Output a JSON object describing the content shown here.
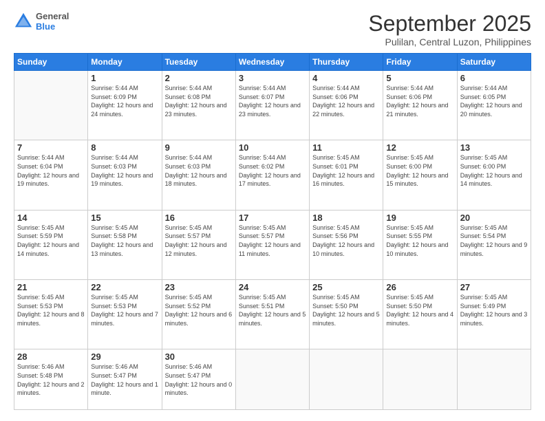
{
  "logo": {
    "general": "General",
    "blue": "Blue"
  },
  "header": {
    "month": "September 2025",
    "location": "Pulilan, Central Luzon, Philippines"
  },
  "weekdays": [
    "Sunday",
    "Monday",
    "Tuesday",
    "Wednesday",
    "Thursday",
    "Friday",
    "Saturday"
  ],
  "weeks": [
    [
      {
        "day": "",
        "sunrise": "",
        "sunset": "",
        "daylight": ""
      },
      {
        "day": "1",
        "sunrise": "Sunrise: 5:44 AM",
        "sunset": "Sunset: 6:09 PM",
        "daylight": "Daylight: 12 hours and 24 minutes."
      },
      {
        "day": "2",
        "sunrise": "Sunrise: 5:44 AM",
        "sunset": "Sunset: 6:08 PM",
        "daylight": "Daylight: 12 hours and 23 minutes."
      },
      {
        "day": "3",
        "sunrise": "Sunrise: 5:44 AM",
        "sunset": "Sunset: 6:07 PM",
        "daylight": "Daylight: 12 hours and 23 minutes."
      },
      {
        "day": "4",
        "sunrise": "Sunrise: 5:44 AM",
        "sunset": "Sunset: 6:06 PM",
        "daylight": "Daylight: 12 hours and 22 minutes."
      },
      {
        "day": "5",
        "sunrise": "Sunrise: 5:44 AM",
        "sunset": "Sunset: 6:06 PM",
        "daylight": "Daylight: 12 hours and 21 minutes."
      },
      {
        "day": "6",
        "sunrise": "Sunrise: 5:44 AM",
        "sunset": "Sunset: 6:05 PM",
        "daylight": "Daylight: 12 hours and 20 minutes."
      }
    ],
    [
      {
        "day": "7",
        "sunrise": "Sunrise: 5:44 AM",
        "sunset": "Sunset: 6:04 PM",
        "daylight": "Daylight: 12 hours and 19 minutes."
      },
      {
        "day": "8",
        "sunrise": "Sunrise: 5:44 AM",
        "sunset": "Sunset: 6:03 PM",
        "daylight": "Daylight: 12 hours and 19 minutes."
      },
      {
        "day": "9",
        "sunrise": "Sunrise: 5:44 AM",
        "sunset": "Sunset: 6:03 PM",
        "daylight": "Daylight: 12 hours and 18 minutes."
      },
      {
        "day": "10",
        "sunrise": "Sunrise: 5:44 AM",
        "sunset": "Sunset: 6:02 PM",
        "daylight": "Daylight: 12 hours and 17 minutes."
      },
      {
        "day": "11",
        "sunrise": "Sunrise: 5:45 AM",
        "sunset": "Sunset: 6:01 PM",
        "daylight": "Daylight: 12 hours and 16 minutes."
      },
      {
        "day": "12",
        "sunrise": "Sunrise: 5:45 AM",
        "sunset": "Sunset: 6:00 PM",
        "daylight": "Daylight: 12 hours and 15 minutes."
      },
      {
        "day": "13",
        "sunrise": "Sunrise: 5:45 AM",
        "sunset": "Sunset: 6:00 PM",
        "daylight": "Daylight: 12 hours and 14 minutes."
      }
    ],
    [
      {
        "day": "14",
        "sunrise": "Sunrise: 5:45 AM",
        "sunset": "Sunset: 5:59 PM",
        "daylight": "Daylight: 12 hours and 14 minutes."
      },
      {
        "day": "15",
        "sunrise": "Sunrise: 5:45 AM",
        "sunset": "Sunset: 5:58 PM",
        "daylight": "Daylight: 12 hours and 13 minutes."
      },
      {
        "day": "16",
        "sunrise": "Sunrise: 5:45 AM",
        "sunset": "Sunset: 5:57 PM",
        "daylight": "Daylight: 12 hours and 12 minutes."
      },
      {
        "day": "17",
        "sunrise": "Sunrise: 5:45 AM",
        "sunset": "Sunset: 5:57 PM",
        "daylight": "Daylight: 12 hours and 11 minutes."
      },
      {
        "day": "18",
        "sunrise": "Sunrise: 5:45 AM",
        "sunset": "Sunset: 5:56 PM",
        "daylight": "Daylight: 12 hours and 10 minutes."
      },
      {
        "day": "19",
        "sunrise": "Sunrise: 5:45 AM",
        "sunset": "Sunset: 5:55 PM",
        "daylight": "Daylight: 12 hours and 10 minutes."
      },
      {
        "day": "20",
        "sunrise": "Sunrise: 5:45 AM",
        "sunset": "Sunset: 5:54 PM",
        "daylight": "Daylight: 12 hours and 9 minutes."
      }
    ],
    [
      {
        "day": "21",
        "sunrise": "Sunrise: 5:45 AM",
        "sunset": "Sunset: 5:53 PM",
        "daylight": "Daylight: 12 hours and 8 minutes."
      },
      {
        "day": "22",
        "sunrise": "Sunrise: 5:45 AM",
        "sunset": "Sunset: 5:53 PM",
        "daylight": "Daylight: 12 hours and 7 minutes."
      },
      {
        "day": "23",
        "sunrise": "Sunrise: 5:45 AM",
        "sunset": "Sunset: 5:52 PM",
        "daylight": "Daylight: 12 hours and 6 minutes."
      },
      {
        "day": "24",
        "sunrise": "Sunrise: 5:45 AM",
        "sunset": "Sunset: 5:51 PM",
        "daylight": "Daylight: 12 hours and 5 minutes."
      },
      {
        "day": "25",
        "sunrise": "Sunrise: 5:45 AM",
        "sunset": "Sunset: 5:50 PM",
        "daylight": "Daylight: 12 hours and 5 minutes."
      },
      {
        "day": "26",
        "sunrise": "Sunrise: 5:45 AM",
        "sunset": "Sunset: 5:50 PM",
        "daylight": "Daylight: 12 hours and 4 minutes."
      },
      {
        "day": "27",
        "sunrise": "Sunrise: 5:45 AM",
        "sunset": "Sunset: 5:49 PM",
        "daylight": "Daylight: 12 hours and 3 minutes."
      }
    ],
    [
      {
        "day": "28",
        "sunrise": "Sunrise: 5:46 AM",
        "sunset": "Sunset: 5:48 PM",
        "daylight": "Daylight: 12 hours and 2 minutes."
      },
      {
        "day": "29",
        "sunrise": "Sunrise: 5:46 AM",
        "sunset": "Sunset: 5:47 PM",
        "daylight": "Daylight: 12 hours and 1 minute."
      },
      {
        "day": "30",
        "sunrise": "Sunrise: 5:46 AM",
        "sunset": "Sunset: 5:47 PM",
        "daylight": "Daylight: 12 hours and 0 minutes."
      },
      {
        "day": "",
        "sunrise": "",
        "sunset": "",
        "daylight": ""
      },
      {
        "day": "",
        "sunrise": "",
        "sunset": "",
        "daylight": ""
      },
      {
        "day": "",
        "sunrise": "",
        "sunset": "",
        "daylight": ""
      },
      {
        "day": "",
        "sunrise": "",
        "sunset": "",
        "daylight": ""
      }
    ]
  ]
}
